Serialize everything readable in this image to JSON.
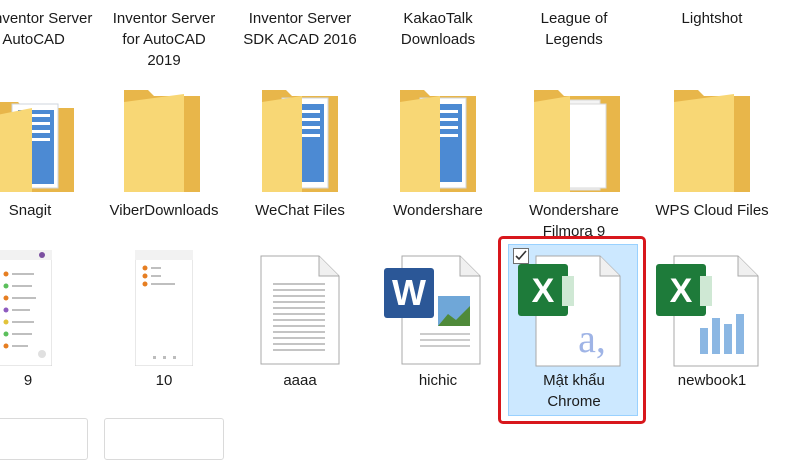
{
  "row1": {
    "labels": [
      [
        "nventor Server",
        "r AutoCAD"
      ],
      [
        "Inventor Server",
        "for AutoCAD",
        "2019"
      ],
      [
        "Inventor Server",
        "SDK ACAD 2016"
      ],
      [
        "KakaoTalk",
        "Downloads"
      ],
      [
        "League of",
        "Legends"
      ],
      [
        "Lightshot"
      ]
    ]
  },
  "row2": {
    "folders": [
      {
        "label": "Snagit",
        "icon": "folder-icon"
      },
      {
        "label": "ViberDownloads",
        "icon": "folder-icon"
      },
      {
        "label": "WeChat Files",
        "icon": "folder-icon"
      },
      {
        "label": "Wondershare",
        "icon": "folder-icon"
      },
      {
        "label_line1": "Wondershare",
        "label_line2": "Filmora 9",
        "icon": "folder-icon"
      },
      {
        "label": "WPS Cloud Files",
        "icon": "folder-icon"
      }
    ]
  },
  "row3": {
    "files": [
      {
        "label": "9",
        "icon": "phone-screenshot-icon"
      },
      {
        "label": "10",
        "icon": "phone-screenshot-icon"
      },
      {
        "label": "aaaa",
        "icon": "text-document-icon"
      },
      {
        "label": "hichic",
        "icon": "word-document-icon"
      },
      {
        "label_line1": "Mật khẩu",
        "label_line2": "Chrome",
        "icon": "excel-file-icon",
        "selected": true
      },
      {
        "label": "newbook1",
        "icon": "excel-chart-file-icon"
      }
    ]
  },
  "colors": {
    "folder_back": "#e8b64a",
    "folder_front": "#f8d775",
    "selection": "#cce8ff",
    "highlight_border": "#d8171c",
    "excel_green": "#1e7b3a",
    "word_blue": "#2b5797"
  }
}
